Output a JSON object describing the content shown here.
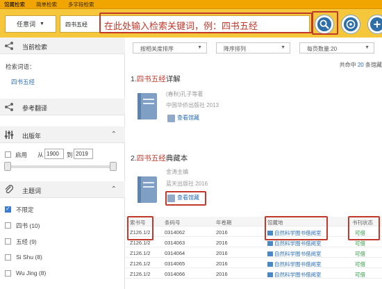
{
  "top_tabs": [
    "馆藏检索",
    "简单检索",
    "多字段检索"
  ],
  "search": {
    "field_select": "任意词",
    "query": "四书五经",
    "annotation": "在此处输入检索关键词，例：四书五经"
  },
  "sidebar": {
    "current_search_title": "当前检索",
    "search_term_label": "检索词语：",
    "search_term_value": "四书五经",
    "reference_translation_title": "参考翻译",
    "pub_year_title": "出版年",
    "enable_label": "启用",
    "from_label": "从",
    "from_year": "1900",
    "to_label": "到",
    "to_year": "2019",
    "subject_title": "主题词",
    "facets": [
      {
        "label": "不限定",
        "checked": true
      },
      {
        "label": "四书 (10)",
        "checked": false
      },
      {
        "label": "五经 (9)",
        "checked": false
      },
      {
        "label": "Si Shu (8)",
        "checked": false
      },
      {
        "label": "Wu Jing (8)",
        "checked": false
      }
    ]
  },
  "controls": {
    "sort": "按相关度排序",
    "order": "降序排列",
    "page_size": "每页数量:20"
  },
  "result_count": {
    "prefix": "共命中",
    "count": "20",
    "suffix": "条馆藏"
  },
  "results": [
    {
      "index": "1.",
      "title_hl": "四书五经",
      "title_rest": "详解",
      "author": "(春秋)孔子等著",
      "publisher": "中国华侨出版社 2013",
      "holdings": "查看馆藏"
    },
    {
      "index": "2.",
      "title_hl": "四书五经",
      "title_rest": "典藏本",
      "author": "金涛主编",
      "publisher": "蓝天出版社 2016",
      "holdings": "查看馆藏"
    }
  ],
  "holdings_table": {
    "headers": [
      "索书号",
      "条码号",
      "年卷期",
      "馆藏地",
      "书刊状态"
    ],
    "rows": [
      [
        "Z126.1/2",
        "0314062",
        "2016",
        "自然科学图书借阅室",
        "可借"
      ],
      [
        "Z126.1/2",
        "0314063",
        "2016",
        "自然科学图书借阅室",
        "可借"
      ],
      [
        "Z126.1/2",
        "0314064",
        "2016",
        "自然科学图书借阅室",
        "可借"
      ],
      [
        "Z126.1/2",
        "0314065",
        "2016",
        "自然科学图书借阅室",
        "可借"
      ],
      [
        "Z126.1/2",
        "0314066",
        "2016",
        "自然科学图书借阅室",
        "可借"
      ]
    ]
  },
  "colors": {
    "accent": "#f6c63b",
    "annotation": "#c0392b",
    "link": "#2a6db5"
  }
}
